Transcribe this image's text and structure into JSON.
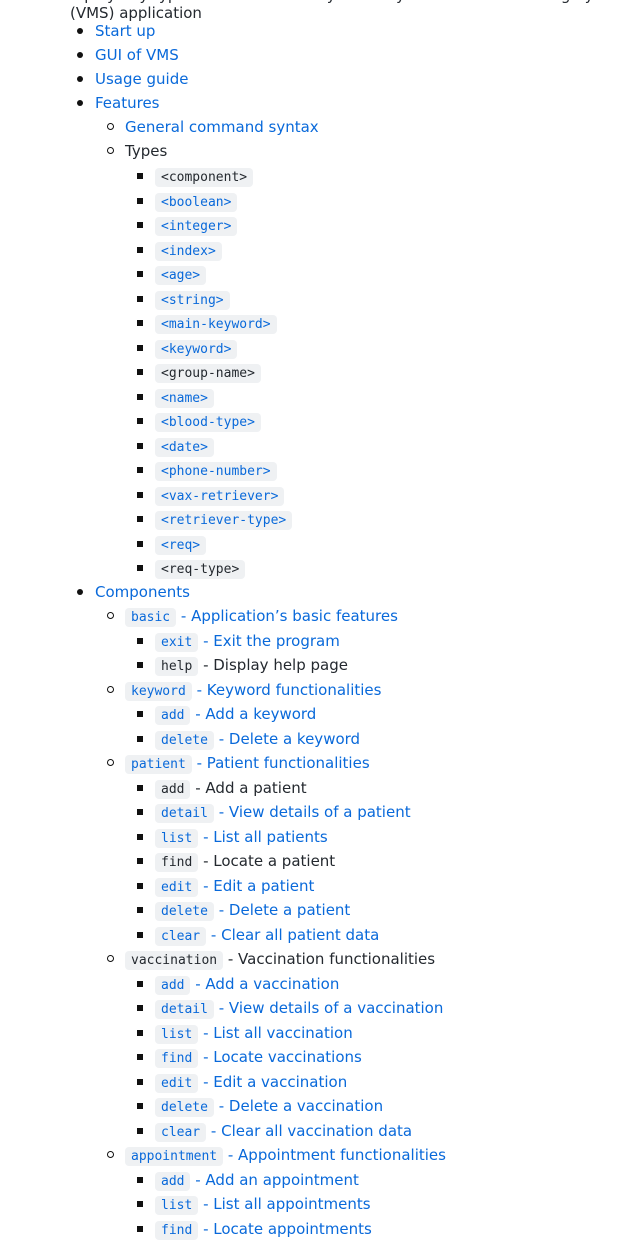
{
  "top_fragment": "...play any type of data related to your entry in the Vax-Monitoring System (VMS) application",
  "toc": [
    {
      "label": "Start up"
    },
    {
      "label": "GUI of VMS"
    },
    {
      "label": "Usage guide"
    },
    {
      "label": "Features"
    },
    {
      "label": "General command syntax"
    },
    {
      "label": "Types"
    },
    {
      "code": "<component>"
    },
    {
      "code": "<boolean>"
    },
    {
      "code": "<integer>"
    },
    {
      "code": "<index>"
    },
    {
      "code": "<age>"
    },
    {
      "code": "<string>"
    },
    {
      "code": "<main-keyword>"
    },
    {
      "code": "<keyword>"
    },
    {
      "code": "<group-name>"
    },
    {
      "code": "<name>"
    },
    {
      "code": "<blood-type>"
    },
    {
      "code": "<date>"
    },
    {
      "code": "<phone-number>"
    },
    {
      "code": "<vax-retriever>"
    },
    {
      "code": "<retriever-type>"
    },
    {
      "code": "<req>"
    },
    {
      "code": "<req-type>"
    },
    {
      "label": "Components"
    },
    {
      "code": "basic",
      "desc": " - Application’s basic features"
    },
    {
      "code": "exit",
      "desc": " - Exit the program"
    },
    {
      "code": "help",
      "desc": " - Display help page"
    },
    {
      "code": "keyword",
      "desc": " - Keyword functionalities"
    },
    {
      "code": "add",
      "desc": " - Add a keyword"
    },
    {
      "code": "delete",
      "desc": " - Delete a keyword"
    },
    {
      "code": "patient",
      "desc": " - Patient functionalities"
    },
    {
      "code": "add",
      "desc": " - Add a patient"
    },
    {
      "code": "detail",
      "desc": " - View details of a patient"
    },
    {
      "code": "list",
      "desc": " - List all patients"
    },
    {
      "code": "find",
      "desc": " - Locate a patient"
    },
    {
      "code": "edit",
      "desc": " - Edit a patient"
    },
    {
      "code": "delete",
      "desc": " - Delete a patient"
    },
    {
      "code": "clear",
      "desc": " - Clear all patient data"
    },
    {
      "code": "vaccination",
      "desc": " - Vaccination functionalities"
    },
    {
      "code": "add",
      "desc": " - Add a vaccination"
    },
    {
      "code": "detail",
      "desc": " - View details of a vaccination"
    },
    {
      "code": "list",
      "desc": " - List all vaccination"
    },
    {
      "code": "find",
      "desc": " - Locate vaccinations"
    },
    {
      "code": "edit",
      "desc": " - Edit a vaccination"
    },
    {
      "code": "delete",
      "desc": " - Delete a vaccination"
    },
    {
      "code": "clear",
      "desc": " - Clear all vaccination data"
    },
    {
      "code": "appointment",
      "desc": " - Appointment functionalities"
    },
    {
      "code": "add",
      "desc": " - Add an appointment"
    },
    {
      "code": "list",
      "desc": " - List all appointments"
    },
    {
      "code": "find",
      "desc": " - Locate appointments"
    }
  ]
}
